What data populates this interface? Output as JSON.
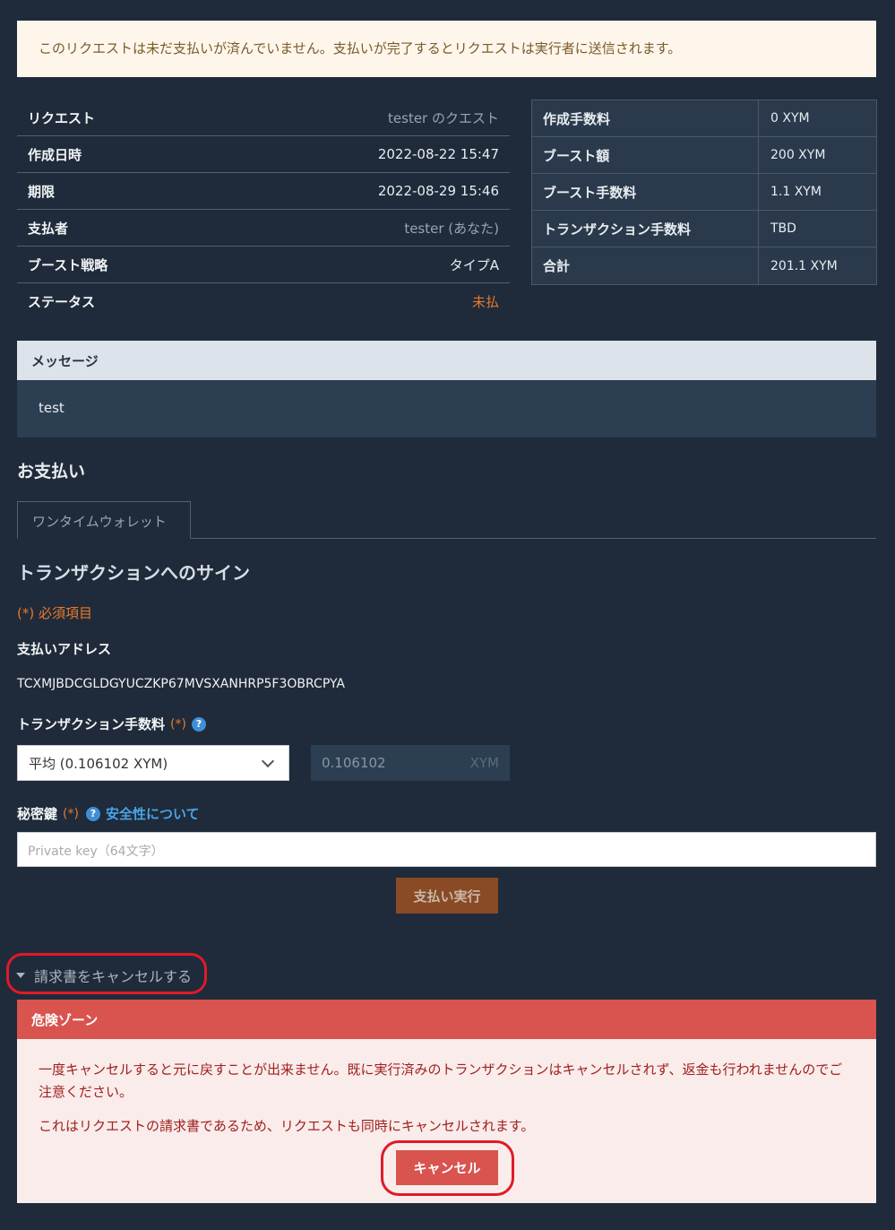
{
  "notice": "このリクエストは未だ支払いが済んでいません。支払いが完了するとリクエストは実行者に送信されます。",
  "info": [
    {
      "key": "リクエスト",
      "value": "tester のクエスト"
    },
    {
      "key": "作成日時",
      "value": "2022-08-22 15:47"
    },
    {
      "key": "期限",
      "value": "2022-08-29 15:46"
    },
    {
      "key": "支払者",
      "value": "tester (あなた)"
    },
    {
      "key": "ブースト戦略",
      "value": "タイプA"
    },
    {
      "key": "ステータス",
      "value": "未払"
    }
  ],
  "fees": [
    {
      "key": "作成手数料",
      "value": "0 XYM"
    },
    {
      "key": "ブースト額",
      "value": "200 XYM"
    },
    {
      "key": "ブースト手数料",
      "value": "1.1 XYM"
    },
    {
      "key": "トランザクション手数料",
      "value": "TBD"
    },
    {
      "key": "合計",
      "value": "201.1 XYM"
    }
  ],
  "message": {
    "title": "メッセージ",
    "body": "test"
  },
  "payment": {
    "section_title": "お支払い",
    "tab": "ワンタイムウォレット",
    "sign_title": "トランザクションへのサイン",
    "required_note": "(*) 必須項目",
    "address_label": "支払いアドレス",
    "address": "TCXMJBDCGLDGYUCZKP67MVSXANHRP5F3OBRCPYA",
    "fee_label": "トランザクション手数料",
    "required_mark": "(*)",
    "fee_select": "平均 (0.106102 XYM)",
    "fee_value": "0.106102",
    "fee_unit": "XYM",
    "key_label": "秘密鍵",
    "security_link": "安全性について",
    "key_placeholder": "Private key（64文字）",
    "pay_button": "支払い実行",
    "help_glyph": "?"
  },
  "cancel": {
    "toggle": "請求書をキャンセルする",
    "danger_title": "危険ゾーン",
    "text1": "一度キャンセルすると元に戻すことが出来ません。既に実行済みのトランザクションはキャンセルされず、返金も行われませんのでご注意ください。",
    "text2": "これはリクエストの請求書であるため、リクエストも同時にキャンセルされます。",
    "button": "キャンセル"
  }
}
